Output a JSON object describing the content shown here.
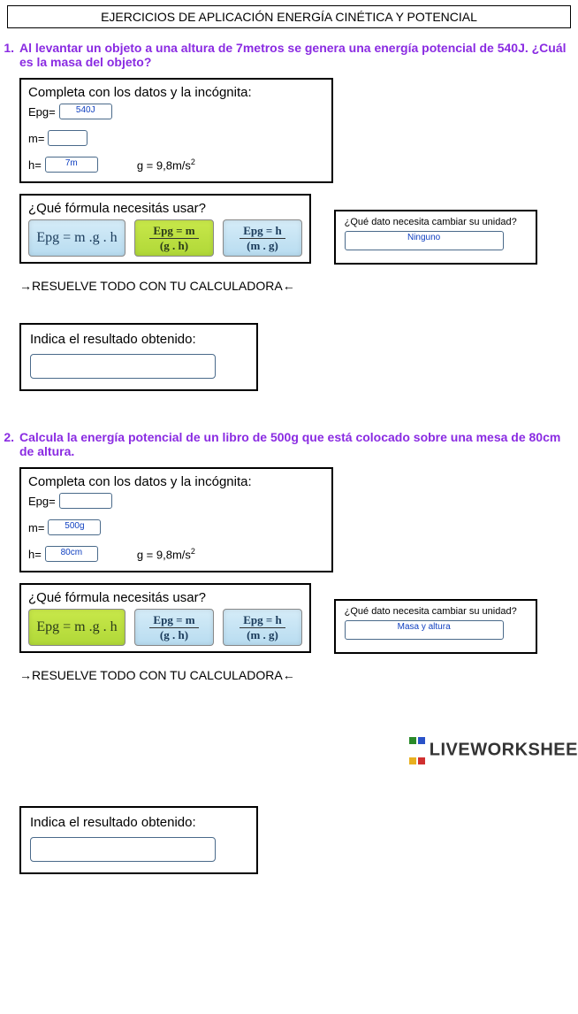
{
  "header": {
    "title": "EJERCICIOS DE APLICACIÓN ENERGÍA CINÉTICA Y POTENCIAL"
  },
  "q1": {
    "num": "1.",
    "text": "Al levantar un objeto a una altura de 7metros se genera una energía potencial de 540J. ¿Cuál es la masa del objeto?",
    "data_title": "Completa con los datos y la incógnita:",
    "epg_label": "Epg=",
    "epg_val": "540J",
    "m_label": "m=",
    "m_val": "",
    "h_label": "h=",
    "h_val": "7m",
    "g_label": "g = 9,8m/s",
    "g_exp": "2",
    "formula_q": "¿Qué fórmula necesitás usar?",
    "f1": "Epg = m .g . h",
    "f2_top": "Epg =   m",
    "f2_bot": "(g . h)",
    "f3_top": "Epg =   h",
    "f3_bot": "(m . g)",
    "unit_q": "¿Qué dato necesita cambiar su unidad?",
    "unit_val": "Ninguno",
    "resolve": "→RESUELVE TODO CON TU CALCULADORA←",
    "result_label": "Indica el resultado obtenido:"
  },
  "q2": {
    "num": "2.",
    "text": "Calcula la energía potencial de un libro de 500g que está colocado sobre una mesa de 80cm de altura.",
    "data_title": "Completa con los datos y la incógnita:",
    "epg_label": "Epg=",
    "epg_val": "",
    "m_label": "m=",
    "m_val": "500g",
    "h_label": "h=",
    "h_val": "80cm",
    "g_label": "g = 9,8m/s",
    "g_exp": "2",
    "formula_q": "¿Qué fórmula necesitás usar?",
    "f1": "Epg = m .g . h",
    "f2_top": "Epg =   m",
    "f2_bot": "(g . h)",
    "f3_top": "Epg =   h",
    "f3_bot": "(m . g)",
    "unit_q": "¿Qué dato necesita cambiar su unidad?",
    "unit_val": "Masa y altura",
    "resolve": "→RESUELVE TODO CON TU CALCULADORA←",
    "result_label": "Indica el resultado obtenido:"
  },
  "watermark": {
    "text": "LIVEWORKSHEE"
  }
}
